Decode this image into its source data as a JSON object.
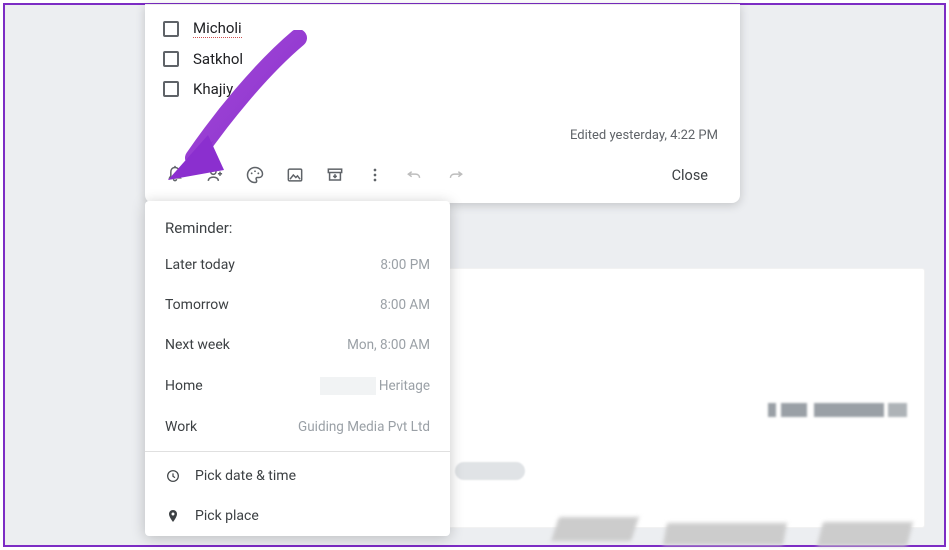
{
  "checklist": [
    {
      "label": "Micholi",
      "misspelled": true
    },
    {
      "label": "Satkhol",
      "misspelled": false
    },
    {
      "label": "Khajiy",
      "misspelled": false,
      "truncated": true
    }
  ],
  "edited_text": "Edited yesterday, 4:22 PM",
  "close_label": "Close",
  "reminder": {
    "title": "Reminder:",
    "options": [
      {
        "label": "Later today",
        "value": "8:00 PM"
      },
      {
        "label": "Tomorrow",
        "value": "8:00 AM"
      },
      {
        "label": "Next week",
        "value": "Mon, 8:00 AM"
      },
      {
        "label": "Home",
        "value_suffix": "Heritage",
        "value_redacted": true
      },
      {
        "label": "Work",
        "value": "Guiding Media Pvt Ltd"
      }
    ],
    "pick_date": "Pick date & time",
    "pick_place": "Pick place"
  }
}
